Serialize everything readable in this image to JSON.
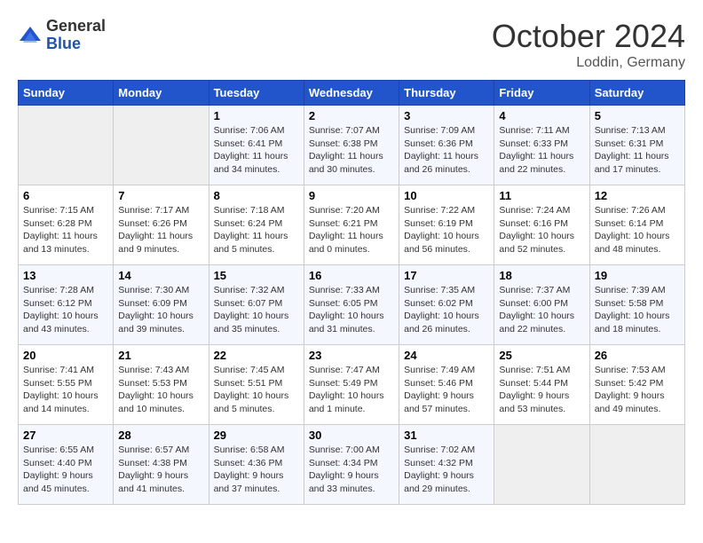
{
  "header": {
    "logo_general": "General",
    "logo_blue": "Blue",
    "month_title": "October 2024",
    "location": "Loddin, Germany"
  },
  "weekdays": [
    "Sunday",
    "Monday",
    "Tuesday",
    "Wednesday",
    "Thursday",
    "Friday",
    "Saturday"
  ],
  "weeks": [
    [
      {
        "day": "",
        "sunrise": "",
        "sunset": "",
        "daylight": ""
      },
      {
        "day": "",
        "sunrise": "",
        "sunset": "",
        "daylight": ""
      },
      {
        "day": "1",
        "sunrise": "Sunrise: 7:06 AM",
        "sunset": "Sunset: 6:41 PM",
        "daylight": "Daylight: 11 hours and 34 minutes."
      },
      {
        "day": "2",
        "sunrise": "Sunrise: 7:07 AM",
        "sunset": "Sunset: 6:38 PM",
        "daylight": "Daylight: 11 hours and 30 minutes."
      },
      {
        "day": "3",
        "sunrise": "Sunrise: 7:09 AM",
        "sunset": "Sunset: 6:36 PM",
        "daylight": "Daylight: 11 hours and 26 minutes."
      },
      {
        "day": "4",
        "sunrise": "Sunrise: 7:11 AM",
        "sunset": "Sunset: 6:33 PM",
        "daylight": "Daylight: 11 hours and 22 minutes."
      },
      {
        "day": "5",
        "sunrise": "Sunrise: 7:13 AM",
        "sunset": "Sunset: 6:31 PM",
        "daylight": "Daylight: 11 hours and 17 minutes."
      }
    ],
    [
      {
        "day": "6",
        "sunrise": "Sunrise: 7:15 AM",
        "sunset": "Sunset: 6:28 PM",
        "daylight": "Daylight: 11 hours and 13 minutes."
      },
      {
        "day": "7",
        "sunrise": "Sunrise: 7:17 AM",
        "sunset": "Sunset: 6:26 PM",
        "daylight": "Daylight: 11 hours and 9 minutes."
      },
      {
        "day": "8",
        "sunrise": "Sunrise: 7:18 AM",
        "sunset": "Sunset: 6:24 PM",
        "daylight": "Daylight: 11 hours and 5 minutes."
      },
      {
        "day": "9",
        "sunrise": "Sunrise: 7:20 AM",
        "sunset": "Sunset: 6:21 PM",
        "daylight": "Daylight: 11 hours and 0 minutes."
      },
      {
        "day": "10",
        "sunrise": "Sunrise: 7:22 AM",
        "sunset": "Sunset: 6:19 PM",
        "daylight": "Daylight: 10 hours and 56 minutes."
      },
      {
        "day": "11",
        "sunrise": "Sunrise: 7:24 AM",
        "sunset": "Sunset: 6:16 PM",
        "daylight": "Daylight: 10 hours and 52 minutes."
      },
      {
        "day": "12",
        "sunrise": "Sunrise: 7:26 AM",
        "sunset": "Sunset: 6:14 PM",
        "daylight": "Daylight: 10 hours and 48 minutes."
      }
    ],
    [
      {
        "day": "13",
        "sunrise": "Sunrise: 7:28 AM",
        "sunset": "Sunset: 6:12 PM",
        "daylight": "Daylight: 10 hours and 43 minutes."
      },
      {
        "day": "14",
        "sunrise": "Sunrise: 7:30 AM",
        "sunset": "Sunset: 6:09 PM",
        "daylight": "Daylight: 10 hours and 39 minutes."
      },
      {
        "day": "15",
        "sunrise": "Sunrise: 7:32 AM",
        "sunset": "Sunset: 6:07 PM",
        "daylight": "Daylight: 10 hours and 35 minutes."
      },
      {
        "day": "16",
        "sunrise": "Sunrise: 7:33 AM",
        "sunset": "Sunset: 6:05 PM",
        "daylight": "Daylight: 10 hours and 31 minutes."
      },
      {
        "day": "17",
        "sunrise": "Sunrise: 7:35 AM",
        "sunset": "Sunset: 6:02 PM",
        "daylight": "Daylight: 10 hours and 26 minutes."
      },
      {
        "day": "18",
        "sunrise": "Sunrise: 7:37 AM",
        "sunset": "Sunset: 6:00 PM",
        "daylight": "Daylight: 10 hours and 22 minutes."
      },
      {
        "day": "19",
        "sunrise": "Sunrise: 7:39 AM",
        "sunset": "Sunset: 5:58 PM",
        "daylight": "Daylight: 10 hours and 18 minutes."
      }
    ],
    [
      {
        "day": "20",
        "sunrise": "Sunrise: 7:41 AM",
        "sunset": "Sunset: 5:55 PM",
        "daylight": "Daylight: 10 hours and 14 minutes."
      },
      {
        "day": "21",
        "sunrise": "Sunrise: 7:43 AM",
        "sunset": "Sunset: 5:53 PM",
        "daylight": "Daylight: 10 hours and 10 minutes."
      },
      {
        "day": "22",
        "sunrise": "Sunrise: 7:45 AM",
        "sunset": "Sunset: 5:51 PM",
        "daylight": "Daylight: 10 hours and 5 minutes."
      },
      {
        "day": "23",
        "sunrise": "Sunrise: 7:47 AM",
        "sunset": "Sunset: 5:49 PM",
        "daylight": "Daylight: 10 hours and 1 minute."
      },
      {
        "day": "24",
        "sunrise": "Sunrise: 7:49 AM",
        "sunset": "Sunset: 5:46 PM",
        "daylight": "Daylight: 9 hours and 57 minutes."
      },
      {
        "day": "25",
        "sunrise": "Sunrise: 7:51 AM",
        "sunset": "Sunset: 5:44 PM",
        "daylight": "Daylight: 9 hours and 53 minutes."
      },
      {
        "day": "26",
        "sunrise": "Sunrise: 7:53 AM",
        "sunset": "Sunset: 5:42 PM",
        "daylight": "Daylight: 9 hours and 49 minutes."
      }
    ],
    [
      {
        "day": "27",
        "sunrise": "Sunrise: 6:55 AM",
        "sunset": "Sunset: 4:40 PM",
        "daylight": "Daylight: 9 hours and 45 minutes."
      },
      {
        "day": "28",
        "sunrise": "Sunrise: 6:57 AM",
        "sunset": "Sunset: 4:38 PM",
        "daylight": "Daylight: 9 hours and 41 minutes."
      },
      {
        "day": "29",
        "sunrise": "Sunrise: 6:58 AM",
        "sunset": "Sunset: 4:36 PM",
        "daylight": "Daylight: 9 hours and 37 minutes."
      },
      {
        "day": "30",
        "sunrise": "Sunrise: 7:00 AM",
        "sunset": "Sunset: 4:34 PM",
        "daylight": "Daylight: 9 hours and 33 minutes."
      },
      {
        "day": "31",
        "sunrise": "Sunrise: 7:02 AM",
        "sunset": "Sunset: 4:32 PM",
        "daylight": "Daylight: 9 hours and 29 minutes."
      },
      {
        "day": "",
        "sunrise": "",
        "sunset": "",
        "daylight": ""
      },
      {
        "day": "",
        "sunrise": "",
        "sunset": "",
        "daylight": ""
      }
    ]
  ]
}
